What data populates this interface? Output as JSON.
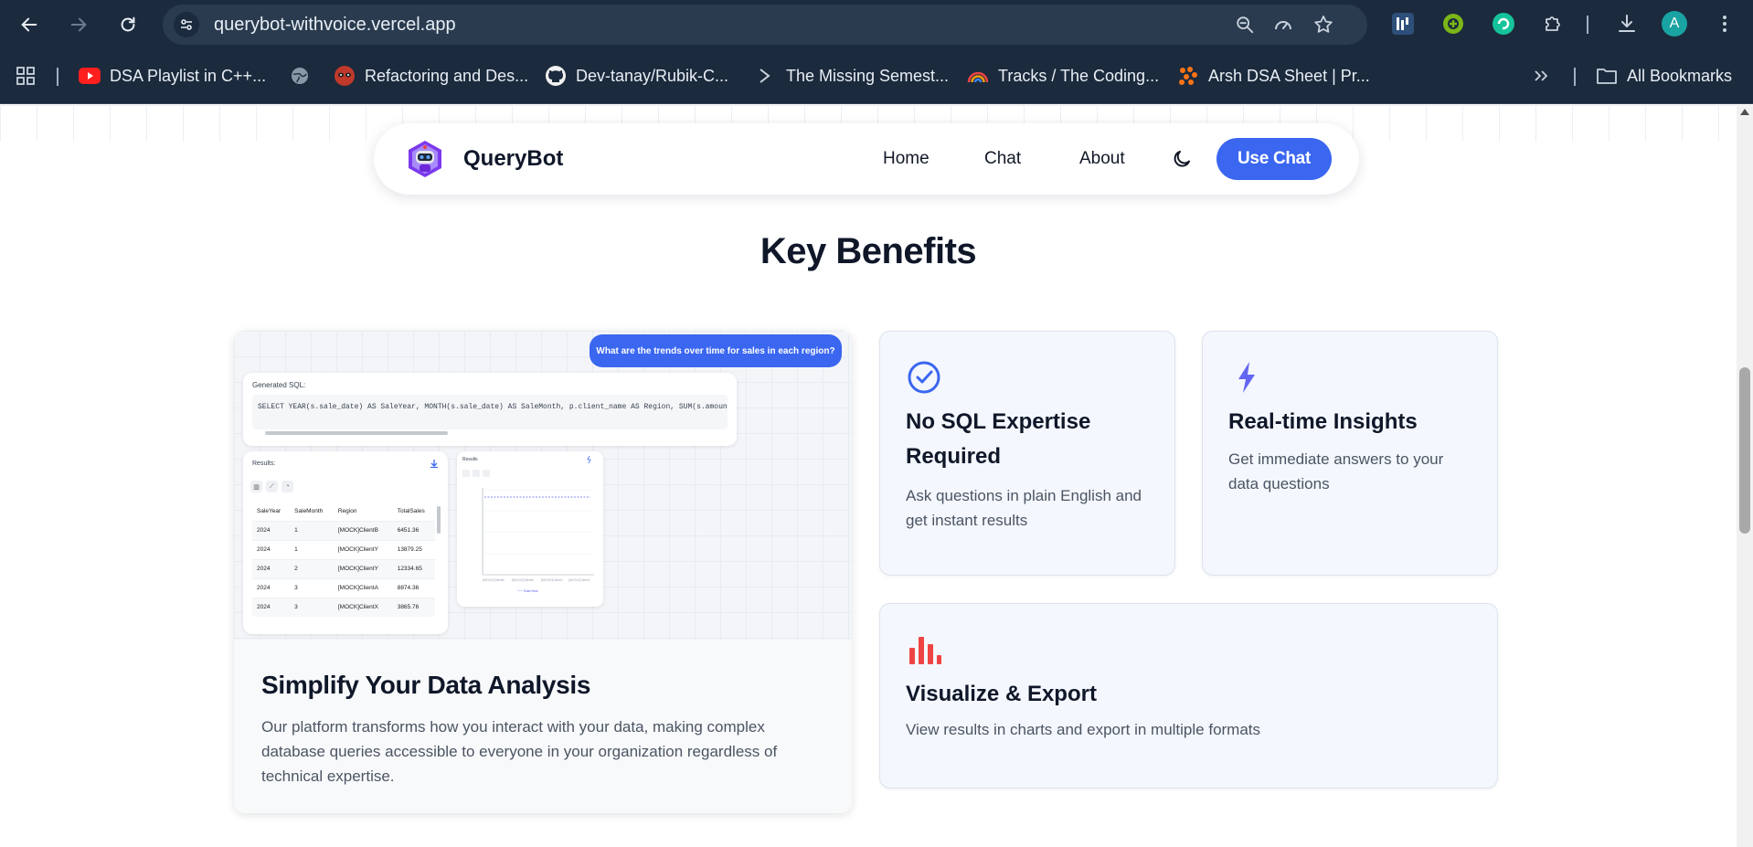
{
  "browser": {
    "url": "querybot-withvoice.vercel.app",
    "profile_initial": "A",
    "bookmarks": [
      {
        "label": "DSA Playlist in C++...",
        "icon": "youtube-icon"
      },
      {
        "label": "Refactoring and Des...",
        "icon": "raccoon-icon"
      },
      {
        "label": "Dev-tanay/Rubik-C...",
        "icon": "github-icon"
      },
      {
        "label": "The Missing Semest...",
        "icon": "terminal-icon"
      },
      {
        "label": "Tracks / The Coding...",
        "icon": "rainbow-icon"
      },
      {
        "label": "Arsh DSA Sheet | Pr...",
        "icon": "dots-logo-icon"
      }
    ],
    "all_bookmarks": "All Bookmarks"
  },
  "nav": {
    "brand": "QueryBot",
    "links": [
      "Home",
      "Chat",
      "About"
    ],
    "cta": "Use Chat"
  },
  "section": {
    "title": "Key Benefits"
  },
  "mockup": {
    "question": "What are the trends over time for sales in each region?",
    "sql_label": "Generated SQL:",
    "sql": "SELECT YEAR(s.sale_date) AS SaleYear, MONTH(s.sale_date) AS SaleMonth, p.client_name AS Region, SUM(s.amount) AS TotalSales FROM",
    "results_label": "Results:",
    "columns": [
      "SaleYear",
      "SaleMonth",
      "Region",
      "TotalSales"
    ],
    "rows": [
      [
        "2024",
        "1",
        "[MOCK]ClientB",
        "6451.36"
      ],
      [
        "2024",
        "1",
        "[MOCK]ClientY",
        "13879.25"
      ],
      [
        "2024",
        "2",
        "[MOCK]ClientY",
        "12334.65"
      ],
      [
        "2024",
        "3",
        "[MOCK]ClientA",
        "8874.36"
      ],
      [
        "2024",
        "3",
        "[MOCK]ClientX",
        "3865.76"
      ]
    ],
    "chart_label": "Results"
  },
  "big_card": {
    "title": "Simplify Your Data Analysis",
    "description": "Our platform transforms how you interact with your data, making complex database queries accessible to everyone in your organization regardless of technical expertise."
  },
  "features": [
    {
      "title_line1": "No SQL Expertise",
      "title_line2": "Required",
      "description": "Ask questions in plain English and get instant results",
      "icon": "check-circle-icon",
      "color": "#3a66f0"
    },
    {
      "title_line1": "Real-time Insights",
      "title_line2": "",
      "description": "Get immediate answers to your data questions",
      "icon": "lightning-icon",
      "color": "#6366f1"
    },
    {
      "title_line1": "Visualize & Export",
      "title_line2": "",
      "description": "View results in charts and export in multiple formats",
      "icon": "bar-chart-icon",
      "color": "#ef4444"
    }
  ],
  "colors": {
    "accent": "#3a66f0",
    "chrome": "#1b2a3c",
    "text": "#0f1729"
  }
}
